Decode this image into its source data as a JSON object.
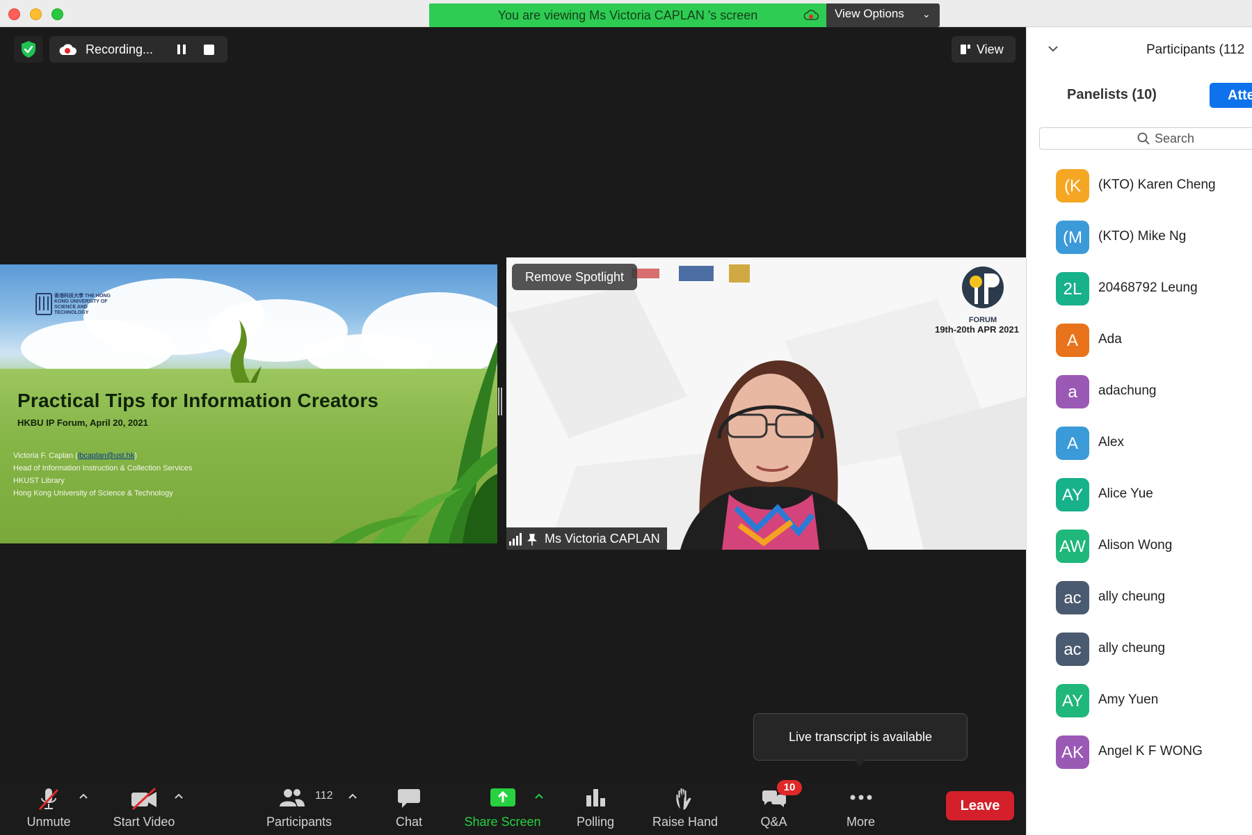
{
  "window": {
    "viewing_banner": "You are viewing Ms Victoria CAPLAN 's screen",
    "view_options": "View Options"
  },
  "top_controls": {
    "recording": "Recording...",
    "view": "View"
  },
  "slide": {
    "logo_text": "香港科技大學 THE HONG KONG UNIVERSITY OF SCIENCE AND TECHNOLOGY",
    "title": "Practical Tips for Information Creators",
    "subtitle": "HKBU IP Forum,  April 20, 2021",
    "presenter": "Victoria F. Caplan (",
    "email": "lbcaplan@ust.hk",
    "presenter_end": ")",
    "position": "Head of Information Instruction & Collection Services",
    "department": "HKUST Library",
    "university": "Hong Kong University of Science & Technology"
  },
  "speaker_video": {
    "remove_spotlight": "Remove Spotlight",
    "forum_label": "FORUM",
    "forum_dates": "19th-20th APR 2021",
    "name": "Ms Victoria CAPLAN"
  },
  "transcript_notice": "Live transcript is available",
  "toolbar": {
    "unmute": "Unmute",
    "start_video": "Start Video",
    "participants": "Participants",
    "participant_count": "112",
    "chat": "Chat",
    "share_screen": "Share Screen",
    "polling": "Polling",
    "raise_hand": "Raise Hand",
    "qa": "Q&A",
    "qa_badge": "10",
    "more": "More",
    "leave": "Leave"
  },
  "panel": {
    "title": "Participants (112",
    "tab_panelists": "Panelists (10)",
    "tab_attendees": "Atte",
    "search_placeholder": "Search",
    "participants": [
      {
        "initials": "(K",
        "name": "(KTO) Karen Cheng",
        "color": "#f5a623"
      },
      {
        "initials": "(M",
        "name": "(KTO) Mike Ng",
        "color": "#3b9ad8"
      },
      {
        "initials": "2L",
        "name": "20468792 Leung",
        "color": "#17b18a"
      },
      {
        "initials": "A",
        "name": "Ada",
        "color": "#e8731a"
      },
      {
        "initials": "a",
        "name": "adachung",
        "color": "#9b59b6"
      },
      {
        "initials": "A",
        "name": "Alex",
        "color": "#3b9ad8"
      },
      {
        "initials": "AY",
        "name": "Alice Yue",
        "color": "#17b18a"
      },
      {
        "initials": "AW",
        "name": "Alison Wong",
        "color": "#1fb77a"
      },
      {
        "initials": "ac",
        "name": "ally cheung",
        "color": "#4a5a70"
      },
      {
        "initials": "ac",
        "name": "ally cheung",
        "color": "#4a5a70"
      },
      {
        "initials": "AY",
        "name": "Amy Yuen",
        "color": "#1fb77a"
      },
      {
        "initials": "AK",
        "name": "Angel K F WONG",
        "color": "#9b59b6"
      }
    ]
  }
}
